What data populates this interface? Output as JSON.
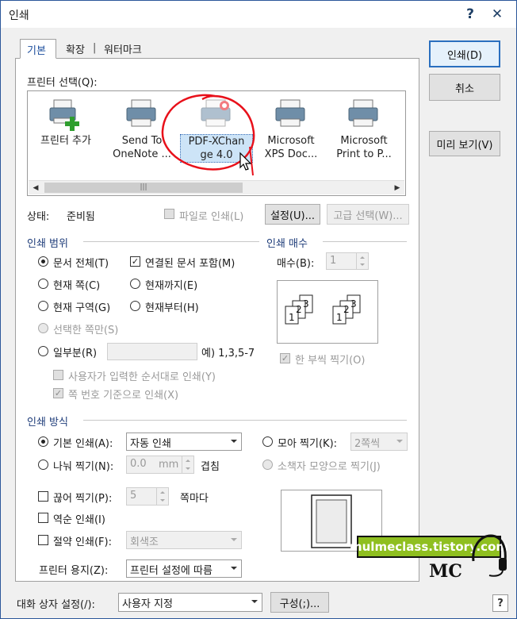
{
  "window": {
    "title": "인쇄",
    "help_glyph": "?",
    "close_glyph": "✕"
  },
  "tabs": [
    {
      "label": "기본"
    },
    {
      "label": "확장"
    },
    {
      "label": "워터마크"
    }
  ],
  "tab_separator": "|",
  "side_buttons": {
    "print": "인쇄(D)",
    "cancel": "취소",
    "preview": "미리 보기(V)"
  },
  "printer_section": {
    "label": "프린터 선택(Q):",
    "printers": [
      {
        "line1": "프린터 추가",
        "line2": "",
        "icon": "add-printer-icon"
      },
      {
        "line1": "Send To",
        "line2": "OneNote ...",
        "icon": "printer-icon"
      },
      {
        "line1": "PDF-XChan",
        "line2": "ge 4.0",
        "icon": "printer-icon",
        "selected": true
      },
      {
        "line1": "Microsoft",
        "line2": "XPS Doc...",
        "icon": "printer-icon"
      },
      {
        "line1": "Microsoft",
        "line2": "Print to P...",
        "icon": "printer-icon"
      }
    ],
    "scroll_left": "◀",
    "scroll_right": "▶",
    "scroll_grip": "|||"
  },
  "status": {
    "label": "상태:",
    "value": "준비됨",
    "print_to_file": "파일로 인쇄(L)",
    "settings_button": "설정(U)...",
    "advanced_button": "고급 선택(W)..."
  },
  "range": {
    "title": "인쇄 범위",
    "all_doc": "문서 전체(T)",
    "include_linked": "연결된 문서 포함(M)",
    "current_page": "현재 쪽(C)",
    "up_to_current": "현재까지(E)",
    "current_section": "현재 구역(G)",
    "from_current": "현재부터(H)",
    "selected_pages": "선택한 쪽만(S)",
    "some_pages": "일부분(R)",
    "some_pages_example": "예) 1,3,5-7",
    "user_order": "사용자가 입력한 순서대로 인쇄(Y)",
    "by_page_number": "쪽 번호 기준으로 인쇄(X)"
  },
  "copies": {
    "title": "인쇄 매수",
    "label": "매수(B):",
    "value": "1",
    "collate": "한 부씩 찍기(O)",
    "page_numbers": [
      "1",
      "2",
      "3"
    ]
  },
  "method": {
    "title": "인쇄 방식",
    "basic": "기본 인쇄(A):",
    "basic_value": "자동 인쇄",
    "nup": "모아 찍기(K):",
    "nup_value": "2쪽씩",
    "split": "나눠 찍기(N):",
    "split_value": "0.0",
    "split_unit": "mm",
    "overlap": "겹침",
    "booklet": "소책자 모양으로 찍기(J)",
    "break_print": "끊어 찍기(P):",
    "break_value": "5",
    "break_unit": "쪽마다",
    "reverse": "역순 인쇄(I)",
    "saving": "절약 인쇄(F):",
    "saving_value": "회색조",
    "paper": "프린터 용지(Z):",
    "paper_value": "프린터 설정에 따름"
  },
  "footer": {
    "dialog_setting_label": "대화 상자 설정(/):",
    "dialog_setting_value": "사용자 지정",
    "config_button": "구성(;)...",
    "help": "?"
  },
  "watermark": {
    "text": "mulmeclass.tistory.com",
    "logo": "MC"
  },
  "colors": {
    "accent": "#2a6fbf",
    "selection": "#cde4f7",
    "annotation": "#e8101a",
    "watermark_bg": "#8fbf20"
  }
}
